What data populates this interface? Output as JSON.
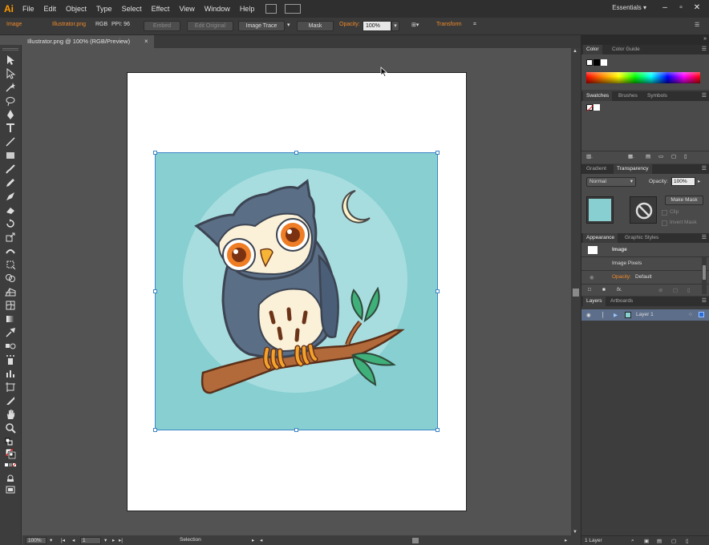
{
  "menu": {
    "logo": "Ai",
    "items": [
      "File",
      "Edit",
      "Object",
      "Type",
      "Select",
      "Effect",
      "View",
      "Window",
      "Help"
    ],
    "workspace": "Essentials"
  },
  "control": {
    "object_type": "Image",
    "filename": "Illustrator.png",
    "color_mode": "RGB",
    "ppi": "PPI: 96",
    "embed": "Embed",
    "edit_original": "Edit Original",
    "image_trace": "Image Trace",
    "mask": "Mask",
    "opacity_label": "Opacity:",
    "opacity_value": "100%",
    "transform": "Transform"
  },
  "doc_tab": {
    "title": "Illustrator.png @ 100% (RGB/Preview)",
    "close": "×"
  },
  "status": {
    "zoom": "100%",
    "artboard": "1",
    "tool": "Selection"
  },
  "panels": {
    "color_tabs": [
      "Color",
      "Color Guide"
    ],
    "swatch_tabs": [
      "Swatches",
      "Brushes",
      "Symbols"
    ],
    "transparency_tabs": [
      "Gradient",
      "Transparency"
    ],
    "blend_mode": "Normal",
    "opacity_label": "Opacity:",
    "opacity_value": "100%",
    "make_mask": "Make Mask",
    "clip": "Clip",
    "invert_mask": "Invert Mask",
    "appearance_tabs": [
      "Appearance",
      "Graphic Styles"
    ],
    "appearance_title": "Image",
    "appearance_pixels": "Image Pixels",
    "appearance_opacity_label": "Opacity:",
    "appearance_opacity_value": "Default",
    "appearance_fx": "fx.",
    "layers_tabs": [
      "Layers",
      "Artboards"
    ],
    "layer_name": "Layer 1",
    "layers_count": "1 Layer"
  },
  "colors": {
    "image_bg": "#87cfd1",
    "circle": "#a8dde0",
    "selection": "#3d86c6",
    "accent_orange": "#f08a2a"
  }
}
